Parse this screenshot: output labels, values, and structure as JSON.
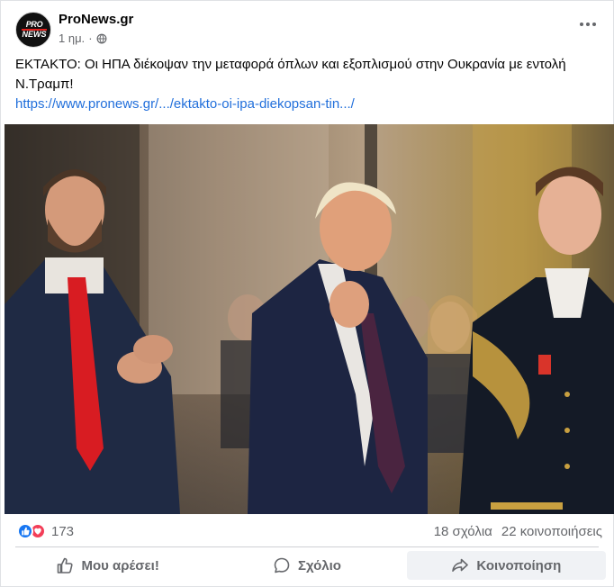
{
  "post": {
    "page_name": "ProNews.gr",
    "avatar": {
      "line1_a": "PRO",
      "line2": "NEWS"
    },
    "time": "1 ημ.",
    "separator": "·",
    "privacy_icon": "globe-icon",
    "more_icon": "more-options-icon",
    "text": "ΕΚΤΑΚΤΟ: Οι ΗΠΑ διέκοψαν την μεταφορά όπλων και εξοπλισμού στην Ουκρανία με εντολή Ν.Τραμπ!",
    "link": "https://www.pronews.gr/.../ektakto-oi-ipa-diekopsan-tin.../"
  },
  "stats": {
    "reaction_count": "173",
    "comments": "18 σχόλια",
    "shares": "22 κοινοποιήσεις"
  },
  "actions": {
    "like_label": "Μου αρέσει!",
    "comment_label": "Σχόλιο",
    "share_label": "Κοινοποίηση"
  },
  "colors": {
    "link": "#216fdb",
    "like_reaction": "#1877f2",
    "love_reaction": "#f33e58",
    "muted_text": "#65676b",
    "brand_red": "#e0201c"
  }
}
